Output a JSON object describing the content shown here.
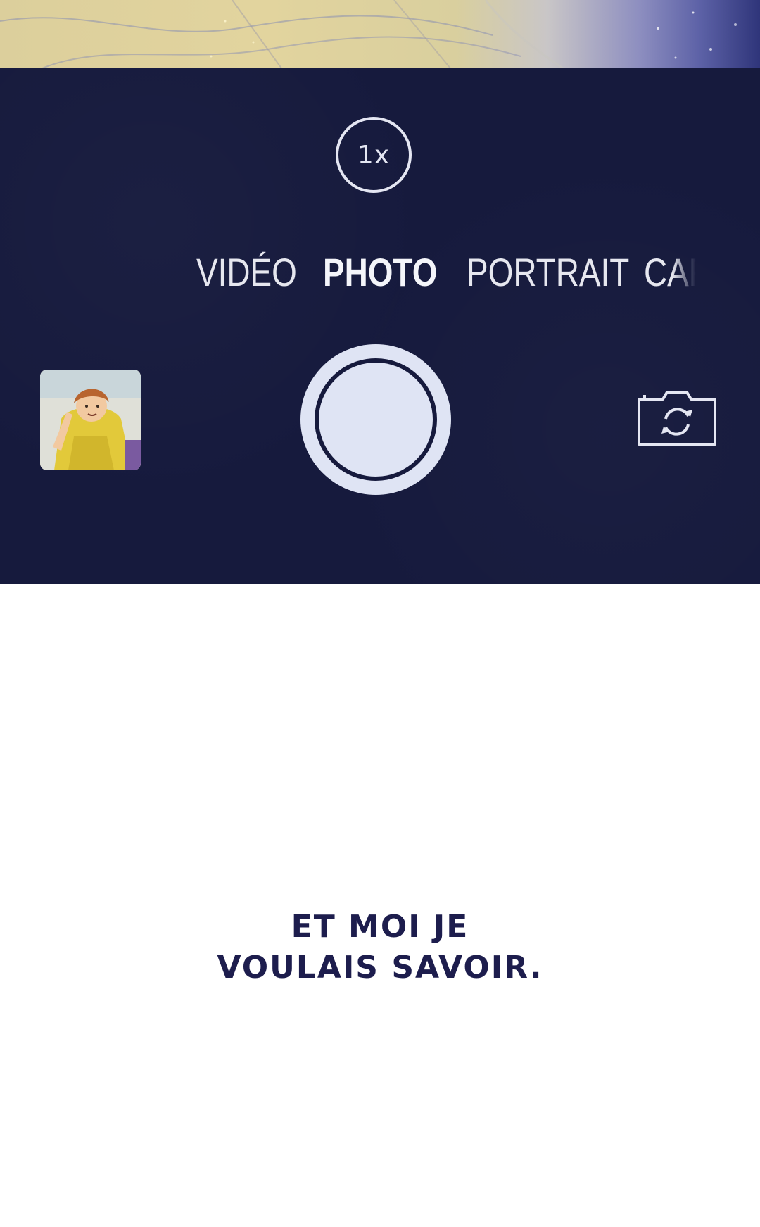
{
  "camera": {
    "zoom_label": "1x",
    "modes": [
      {
        "label": "VIDÉO",
        "selected": false
      },
      {
        "label": "PHOTO",
        "selected": true
      },
      {
        "label": "PORTRAIT",
        "selected": false
      },
      {
        "label": "CARRÉ",
        "selected": false
      }
    ],
    "gallery_thumbnail": "last-photo-thumbnail",
    "shutter_icon": "shutter-button",
    "flip_icon": "flip-camera-icon"
  },
  "caption": {
    "line1": "ET MOI JE",
    "line2": "VOULAIS SAVOIR."
  },
  "colors": {
    "panel": "#161a3d",
    "caption_text": "#1d1d4d",
    "control_white": "#e4e6f2"
  }
}
